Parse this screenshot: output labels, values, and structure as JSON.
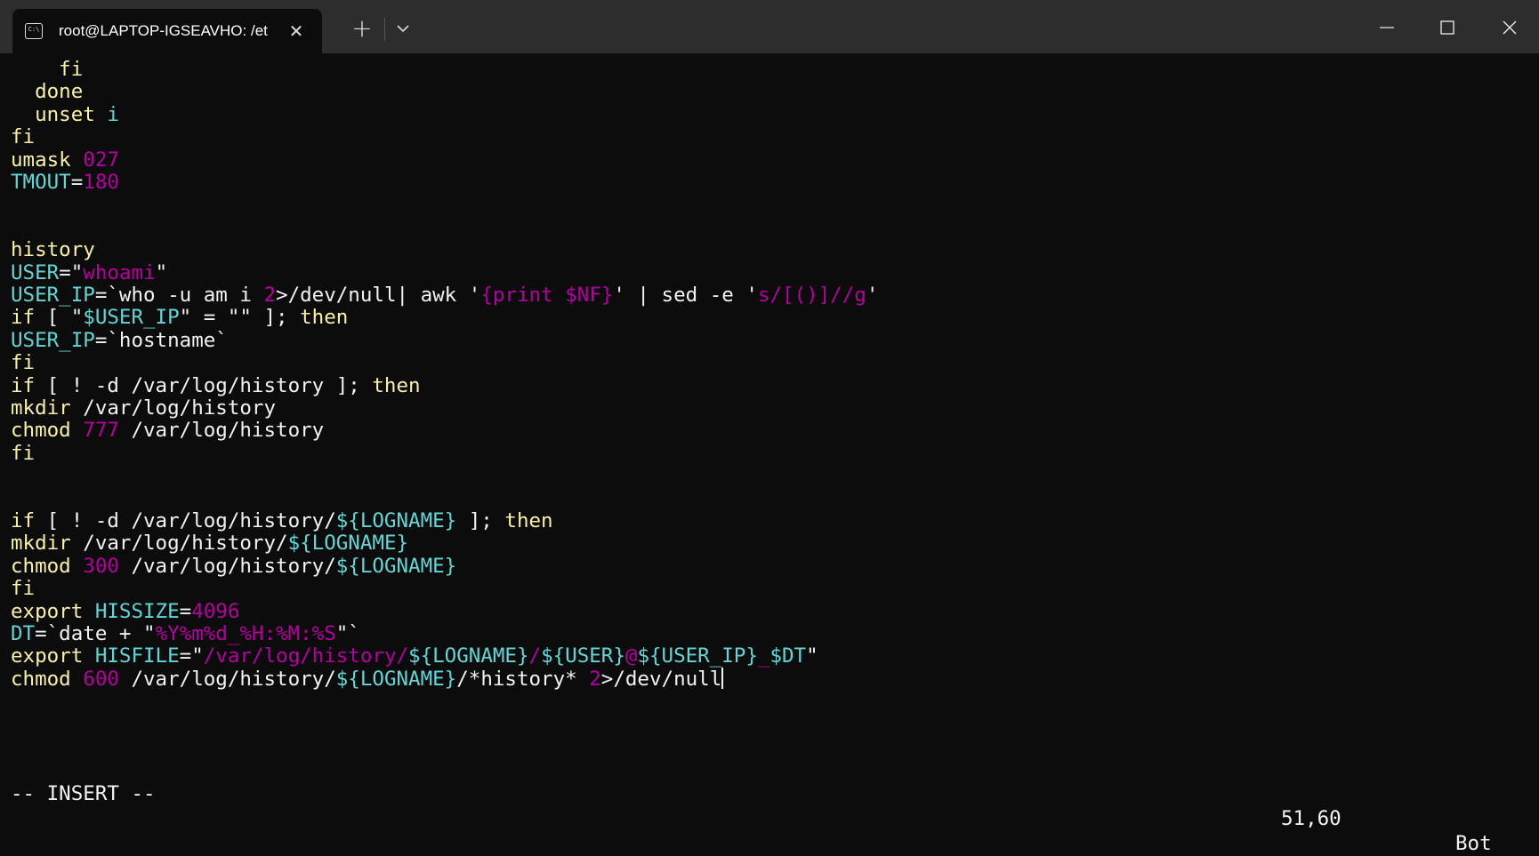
{
  "window": {
    "tab_title": "root@LAPTOP-IGSEAVHO: /et",
    "tab_icon": "C:\\",
    "tab_close": "✕",
    "new_tab": "+"
  },
  "colors": {
    "background": "#0c0c0c",
    "titlebar": "#2d2d2d",
    "keyword": "#f9f1a5",
    "identifier": "#61d6d6",
    "literal": "#b4009e",
    "text": "#f2f2f2"
  },
  "lines": [
    [
      {
        "t": "    fi",
        "c": "y"
      }
    ],
    [
      {
        "t": "  done",
        "c": "y"
      }
    ],
    [
      {
        "t": "  unset ",
        "c": "y"
      },
      {
        "t": "i",
        "c": "c"
      }
    ],
    [
      {
        "t": "fi",
        "c": "y"
      }
    ],
    [
      {
        "t": "umask ",
        "c": "y"
      },
      {
        "t": "027",
        "c": "m"
      }
    ],
    [
      {
        "t": "TMOUT",
        "c": "c"
      },
      {
        "t": "=",
        "c": "w"
      },
      {
        "t": "180",
        "c": "m"
      }
    ],
    [],
    [],
    [
      {
        "t": "history",
        "c": "y"
      }
    ],
    [
      {
        "t": "USER",
        "c": "c"
      },
      {
        "t": "=\"",
        "c": "w"
      },
      {
        "t": "whoami",
        "c": "m"
      },
      {
        "t": "\"",
        "c": "w"
      }
    ],
    [
      {
        "t": "USER_IP",
        "c": "c"
      },
      {
        "t": "=`who -u am i ",
        "c": "w"
      },
      {
        "t": "2",
        "c": "m"
      },
      {
        "t": ">/dev/null| awk '",
        "c": "w"
      },
      {
        "t": "{print $NF}",
        "c": "m"
      },
      {
        "t": "' | sed -e '",
        "c": "w"
      },
      {
        "t": "s/[()]//g",
        "c": "m"
      },
      {
        "t": "'",
        "c": "w"
      }
    ],
    [
      {
        "t": "if",
        "c": "y"
      },
      {
        "t": " [ \"",
        "c": "w"
      },
      {
        "t": "$USER_IP",
        "c": "c"
      },
      {
        "t": "\" = \"\" ]; ",
        "c": "w"
      },
      {
        "t": "then",
        "c": "y"
      }
    ],
    [
      {
        "t": "USER_IP",
        "c": "c"
      },
      {
        "t": "=`hostname`",
        "c": "w"
      }
    ],
    [
      {
        "t": "fi",
        "c": "y"
      }
    ],
    [
      {
        "t": "if",
        "c": "y"
      },
      {
        "t": " [ ! -d /var/log/history ]; ",
        "c": "w"
      },
      {
        "t": "then",
        "c": "y"
      }
    ],
    [
      {
        "t": "mkdir",
        "c": "y"
      },
      {
        "t": " /var/log/history",
        "c": "w"
      }
    ],
    [
      {
        "t": "chmod",
        "c": "y"
      },
      {
        "t": " ",
        "c": "w"
      },
      {
        "t": "777",
        "c": "m"
      },
      {
        "t": " /var/log/history",
        "c": "w"
      }
    ],
    [
      {
        "t": "fi",
        "c": "y"
      }
    ],
    [],
    [],
    [
      {
        "t": "if",
        "c": "y"
      },
      {
        "t": " [ ! -d /var/log/history/",
        "c": "w"
      },
      {
        "t": "${LOGNAME}",
        "c": "c"
      },
      {
        "t": " ]; ",
        "c": "w"
      },
      {
        "t": "then",
        "c": "y"
      }
    ],
    [
      {
        "t": "mkdir",
        "c": "y"
      },
      {
        "t": " /var/log/history/",
        "c": "w"
      },
      {
        "t": "${LOGNAME}",
        "c": "c"
      }
    ],
    [
      {
        "t": "chmod",
        "c": "y"
      },
      {
        "t": " ",
        "c": "w"
      },
      {
        "t": "300",
        "c": "m"
      },
      {
        "t": " /var/log/history/",
        "c": "w"
      },
      {
        "t": "${LOGNAME}",
        "c": "c"
      }
    ],
    [
      {
        "t": "fi",
        "c": "y"
      }
    ],
    [
      {
        "t": "export ",
        "c": "y"
      },
      {
        "t": "HISSIZE",
        "c": "c"
      },
      {
        "t": "=",
        "c": "w"
      },
      {
        "t": "4096",
        "c": "m"
      }
    ],
    [
      {
        "t": "DT",
        "c": "c"
      },
      {
        "t": "=`date + \"",
        "c": "w"
      },
      {
        "t": "%Y%m%d_%H:%M:%S",
        "c": "m"
      },
      {
        "t": "\"`",
        "c": "w"
      }
    ],
    [
      {
        "t": "export ",
        "c": "y"
      },
      {
        "t": "HISFILE",
        "c": "c"
      },
      {
        "t": "=\"",
        "c": "w"
      },
      {
        "t": "/var/log/history/",
        "c": "m"
      },
      {
        "t": "${LOGNAME}",
        "c": "c"
      },
      {
        "t": "/",
        "c": "m"
      },
      {
        "t": "${USER}",
        "c": "c"
      },
      {
        "t": "@",
        "c": "m"
      },
      {
        "t": "${USER_IP}",
        "c": "c"
      },
      {
        "t": "_",
        "c": "m"
      },
      {
        "t": "$DT",
        "c": "c"
      },
      {
        "t": "\"",
        "c": "w"
      }
    ],
    [
      {
        "t": "chmod",
        "c": "y"
      },
      {
        "t": " ",
        "c": "w"
      },
      {
        "t": "600",
        "c": "m"
      },
      {
        "t": " /var/log/history/",
        "c": "w"
      },
      {
        "t": "${LOGNAME}",
        "c": "c"
      },
      {
        "t": "/*history* ",
        "c": "w"
      },
      {
        "t": "2",
        "c": "m"
      },
      {
        "t": ">/dev/null",
        "c": "w"
      }
    ]
  ],
  "status": {
    "mode": "-- INSERT --",
    "position": "51,60",
    "scroll": "Bot"
  }
}
